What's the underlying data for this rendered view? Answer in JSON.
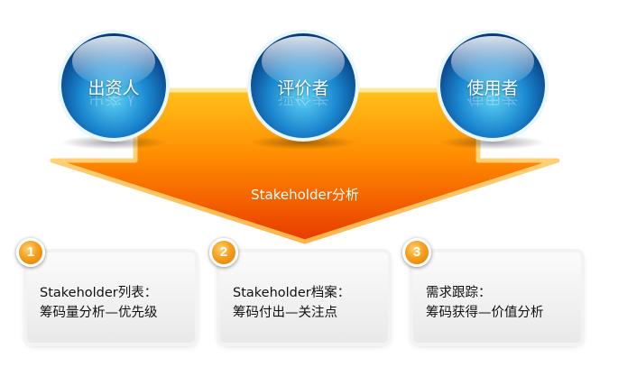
{
  "stakeholders": [
    {
      "label": "出资人"
    },
    {
      "label": "评价者"
    },
    {
      "label": "使用者"
    }
  ],
  "arrow": {
    "label": "Stakeholder分析"
  },
  "steps": [
    {
      "number": "1",
      "line1": "Stakeholder列表：",
      "line2": "筹码量分析—优先级"
    },
    {
      "number": "2",
      "line1": "Stakeholder档案：",
      "line2": "筹码付出—关注点"
    },
    {
      "number": "3",
      "line1": "需求跟踪：",
      "line2": "筹码获得—价值分析"
    }
  ],
  "colors": {
    "arrow_top": "#ffb000",
    "arrow_bottom": "#e83800",
    "sphere_light": "#7fe0ff",
    "sphere_dark": "#0a4f96",
    "badge": "#f5a01c"
  }
}
